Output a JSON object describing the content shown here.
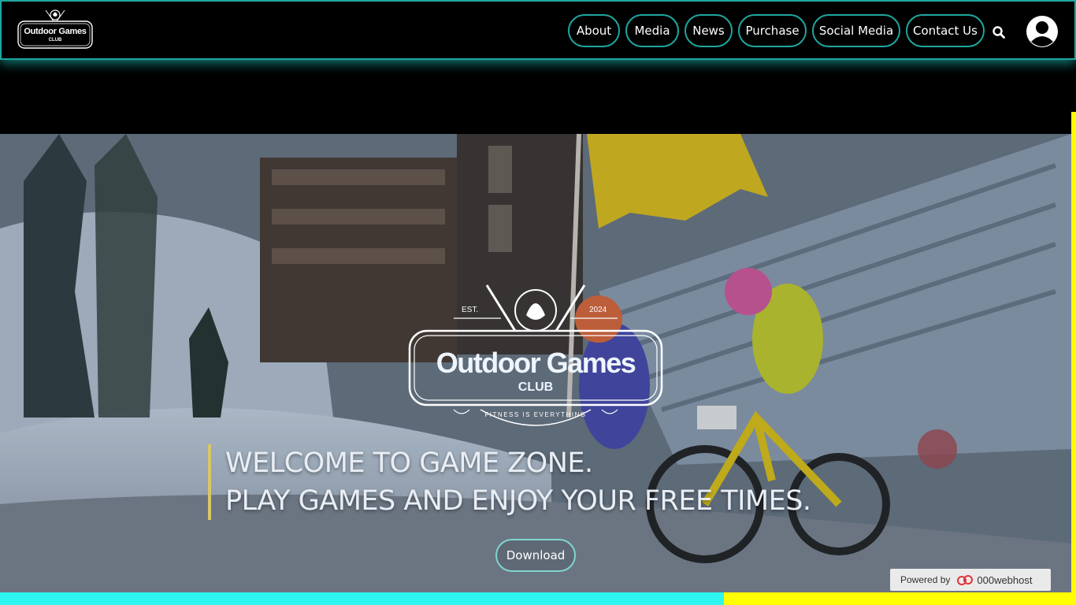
{
  "brand": {
    "logo_name": "Outdoor Games",
    "logo_sub": "CLUB"
  },
  "nav": {
    "items": [
      {
        "label": "About"
      },
      {
        "label": "Media"
      },
      {
        "label": "News"
      },
      {
        "label": "Purchase"
      },
      {
        "label": "Social Media"
      },
      {
        "label": "Contact Us"
      }
    ],
    "search_icon": "search-icon",
    "account_icon": "user-avatar-icon"
  },
  "hero": {
    "logo": {
      "est": "EST.",
      "year": "2024",
      "title": "Outdoor Games",
      "club": "CLUB",
      "tagline": "FITNESS IS EVERYTHING"
    },
    "headline_line1": "WELCOME TO GAME ZONE.",
    "headline_line2": "PLAY GAMES AND ENJOY YOUR FREE TIMES.",
    "download_label": "Download"
  },
  "footer_badge": {
    "powered_by": "Powered by",
    "brand": "000webhost"
  },
  "colors": {
    "accent_teal": "#1ea7a0",
    "bar_cyan": "#2ef5ef",
    "bar_yellow": "#ffff00",
    "headline_border": "#d8c66a"
  }
}
